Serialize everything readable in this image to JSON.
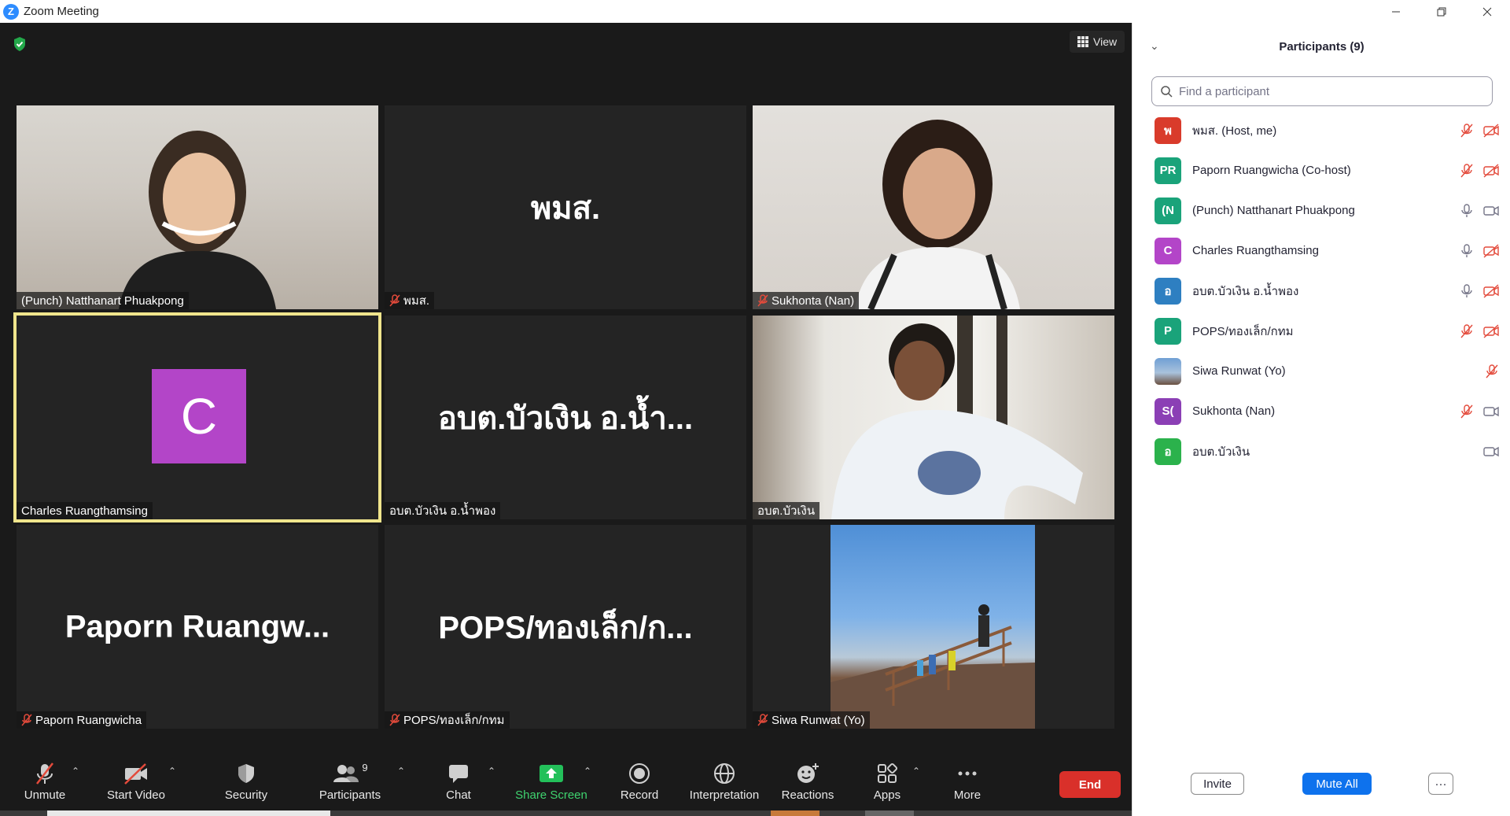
{
  "window": {
    "title": "Zoom Meeting",
    "app_logo": "Z",
    "minimize_icon": "minimize-icon",
    "restore_icon": "restore-icon",
    "close_icon": "close-icon"
  },
  "meeting": {
    "view_label": "View",
    "tiles": [
      {
        "name": "(Punch) Natthanart Phuakpong",
        "big_name": "",
        "muted": false,
        "video": true
      },
      {
        "name": "พมส.",
        "big_name": "พมส.",
        "muted": true,
        "video": false
      },
      {
        "name": "Sukhonta (Nan)",
        "big_name": "",
        "muted": true,
        "video": true
      },
      {
        "name": "Charles Ruangthamsing",
        "big_name": "",
        "avatar_letter": "C",
        "muted": false,
        "video": false,
        "active": true
      },
      {
        "name": "อบต.บัวเงิน อ.น้ำพอง",
        "big_name": "อบต.บัวเงิน อ.น้ำ...",
        "muted": false,
        "video": false
      },
      {
        "name": "อบต.บัวเงิน",
        "big_name": "",
        "muted": false,
        "video": true
      },
      {
        "name": "Paporn Ruangwicha",
        "big_name": "Paporn  Ruangw...",
        "muted": true,
        "video": false
      },
      {
        "name": "POPS/ทองเล็ก/กทม",
        "big_name": "POPS/ทองเล็ก/ก...",
        "muted": true,
        "video": false
      },
      {
        "name": "Siwa Runwat (Yo)",
        "big_name": "",
        "muted": true,
        "video": true
      }
    ]
  },
  "toolbar": {
    "unmute": "Unmute",
    "start_video": "Start Video",
    "security": "Security",
    "participants": "Participants",
    "participants_count": "9",
    "chat": "Chat",
    "share_screen": "Share Screen",
    "record": "Record",
    "interpretation": "Interpretation",
    "reactions": "Reactions",
    "apps": "Apps",
    "more": "More",
    "end": "End"
  },
  "panel": {
    "title": "Participants (9)",
    "search_placeholder": "Find a participant",
    "participants": [
      {
        "initials": "พ",
        "name": "พมส. (Host, me)",
        "color": "#d93b2b",
        "mic": "muted",
        "video": "off"
      },
      {
        "initials": "PR",
        "name": "Paporn Ruangwicha (Co-host)",
        "color": "#1aa37a",
        "mic": "muted",
        "video": "off"
      },
      {
        "initials": "(N",
        "name": "(Punch) Natthanart Phuakpong",
        "color": "#1aa37a",
        "mic": "on",
        "video": "on"
      },
      {
        "initials": "C",
        "name": "Charles Ruangthamsing",
        "color": "#b345c8",
        "mic": "on",
        "video": "off"
      },
      {
        "initials": "อ",
        "name": "อบต.บัวเงิน อ.น้ำพอง",
        "color": "#2e7fc1",
        "mic": "on",
        "video": "off"
      },
      {
        "initials": "P",
        "name": "POPS/ทองเล็ก/กทม",
        "color": "#1aa37a",
        "mic": "muted",
        "video": "off"
      },
      {
        "initials": "",
        "name": "Siwa Runwat (Yo)",
        "color": "#7fa3c8",
        "mic": "muted",
        "video": "none"
      },
      {
        "initials": "S(",
        "name": "Sukhonta (Nan)",
        "color": "#8b3fb5",
        "mic": "muted",
        "video": "on"
      },
      {
        "initials": "อ",
        "name": "อบต.บัวเงิน",
        "color": "#2bb24c",
        "mic": "none",
        "video": "on"
      }
    ],
    "invite": "Invite",
    "mute_all": "Mute All",
    "more": "···"
  }
}
